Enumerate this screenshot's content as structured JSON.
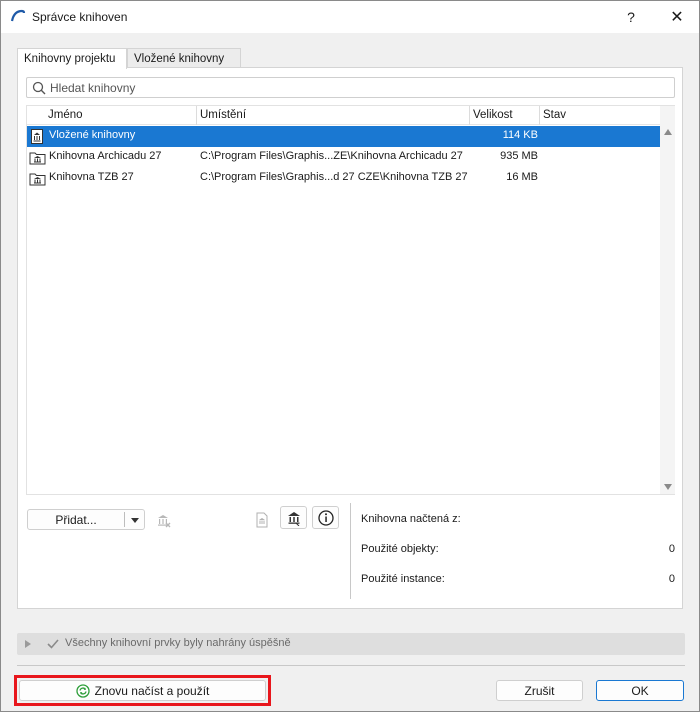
{
  "window": {
    "title": "Správce knihoven",
    "help_label": "?",
    "close_label": "✕"
  },
  "tabs": [
    {
      "label": "Knihovny projektu",
      "active": true
    },
    {
      "label": "Vložené knihovny",
      "active": false
    }
  ],
  "search": {
    "placeholder": "Hledat knihovny"
  },
  "table": {
    "columns": [
      "Jméno",
      "Umístění",
      "Velikost",
      "Stav"
    ],
    "rows": [
      {
        "name": "Vložené knihovny",
        "location": "",
        "size": "114 KB",
        "state": "",
        "selected": true,
        "icon": "embedded-library-icon"
      },
      {
        "name": "Knihovna Archicadu 27",
        "location": "C:\\Program Files\\Graphis...ZE\\Knihovna Archicadu 27",
        "size": "935 MB",
        "state": "",
        "selected": false,
        "icon": "library-folder-icon"
      },
      {
        "name": "Knihovna TZB 27",
        "location": "C:\\Program Files\\Graphis...d 27 CZE\\Knihovna TZB 27",
        "size": "16 MB",
        "state": "",
        "selected": false,
        "icon": "library-folder-icon"
      }
    ]
  },
  "toolbar": {
    "add_label": "Přidat...",
    "icons": [
      "dropdown-arrow-icon",
      "remove-library-icon",
      "library-file-icon",
      "library-building-icon",
      "info-icon"
    ]
  },
  "info": {
    "loaded_from_label": "Knihovna načtená z:",
    "loaded_from_value": "",
    "used_objects_label": "Použité objekty:",
    "used_objects_value": "0",
    "used_instances_label": "Použité instance:",
    "used_instances_value": "0"
  },
  "status": {
    "text": "Všechny knihovní prvky byly nahrány úspěšně"
  },
  "footer": {
    "reload_label": "Znovu načíst a použít",
    "cancel_label": "Zrušit",
    "ok_label": "OK"
  },
  "colors": {
    "selection": "#1a78d2",
    "highlight_border": "#e8161c",
    "ok_border": "#1a78d2"
  }
}
